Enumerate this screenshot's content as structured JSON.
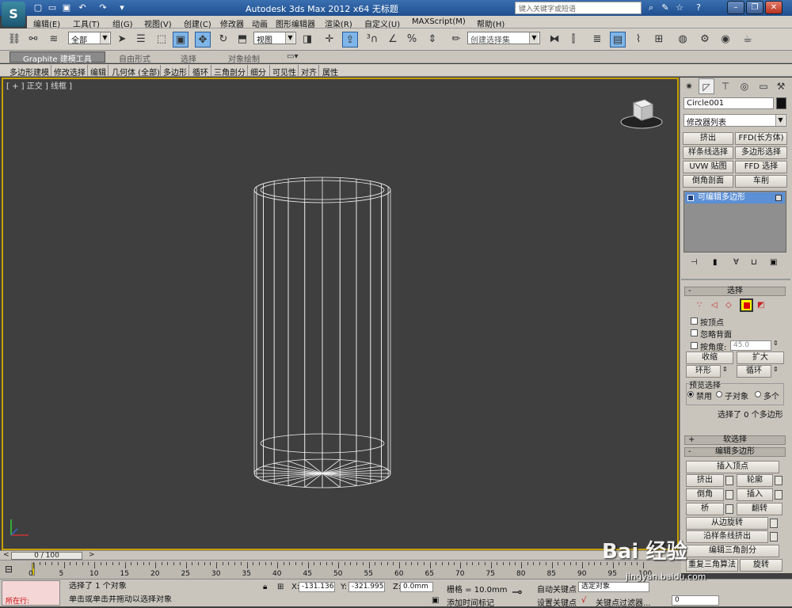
{
  "titlebar": {
    "title": "Autodesk 3ds Max  2012 x64      无标题",
    "search_placeholder": "键入关键字或短语"
  },
  "menu": [
    "编辑(E)",
    "工具(T)",
    "组(G)",
    "视图(V)",
    "创建(C)",
    "修改器",
    "动画",
    "图形编辑器",
    "渲染(R)",
    "自定义(U)",
    "MAXScript(M)",
    "帮助(H)"
  ],
  "toolbar": {
    "selection_filter": "全部",
    "reference_coord": "视图",
    "named_selection": "创建选择集"
  },
  "ribbon": {
    "tabs": [
      "Graphite 建模工具",
      "自由形式",
      "选择",
      "对象绘制"
    ],
    "subtabs": [
      "多边形建模",
      "修改选择",
      "编辑",
      "几何体 (全部)",
      "多边形",
      "循环",
      "三角剖分",
      "细分",
      "可见性",
      "对齐",
      "属性"
    ]
  },
  "viewport": {
    "label": "[ + ] 正交 ] 线框 ]"
  },
  "command_panel": {
    "object_name": "Circle001",
    "modifier_list": "修改器列表",
    "quick_buttons": [
      "挤出",
      "FFD(长方体)",
      "样条线选择",
      "多边形选择",
      "UVW 贴图",
      "FFD 选择",
      "倒角剖面",
      "车削"
    ],
    "stack_item": "可编辑多边形",
    "selection_rollout": {
      "title": "选择",
      "by_vertex": "按顶点",
      "ignore_backfacing": "忽略背面",
      "by_angle": "按角度:",
      "angle_value": "45.0",
      "shrink": "收缩",
      "grow": "扩大",
      "ring": "环形",
      "loop": "循环",
      "preview_label": "预览选择",
      "preview_options": [
        "禁用",
        "子对象",
        "多个"
      ],
      "status": "选择了 0 个多边形"
    },
    "soft_selection": "软选择",
    "edit_polygons": {
      "title": "编辑多边形",
      "insert_vertex": "插入顶点",
      "buttons": [
        "挤出",
        "轮廓",
        "倒角",
        "插入",
        "桥",
        "翻转"
      ],
      "hinge_from_edge": "从边旋转",
      "extrude_along_spline": "沿样条线挤出",
      "edit_triangulation": "编辑三角剖分",
      "retriangulate": "重复三角算法",
      "turn": "旋转"
    }
  },
  "timeline": {
    "frame_display": "0 / 100",
    "ticks": [
      "0",
      "5",
      "10",
      "15",
      "20",
      "25",
      "30",
      "35",
      "40",
      "45",
      "50",
      "55",
      "60",
      "65",
      "70",
      "75",
      "80",
      "85",
      "90",
      "95",
      "100"
    ]
  },
  "status": {
    "prompt_top": "选择了 1 个对象",
    "prompt_bottom": "单击或单击并拖动以选择对象",
    "maxscript_label": "所在行:",
    "x_label": "X:",
    "x_value": "-131.136m",
    "y_label": "Y:",
    "y_value": "-321.995m",
    "z_label": "Z:",
    "z_value": "0.0mm",
    "grid": "栅格 = 10.0mm",
    "add_time_tag": "添加时间标记",
    "auto_key": "自动关键点",
    "set_key": "设置关键点",
    "selected_object": "选定对象",
    "key_filters": "关键点过滤器...",
    "frame_field": "0"
  },
  "watermark": {
    "brand": "Bai 经验",
    "url": "jingyan.baidu.com"
  }
}
